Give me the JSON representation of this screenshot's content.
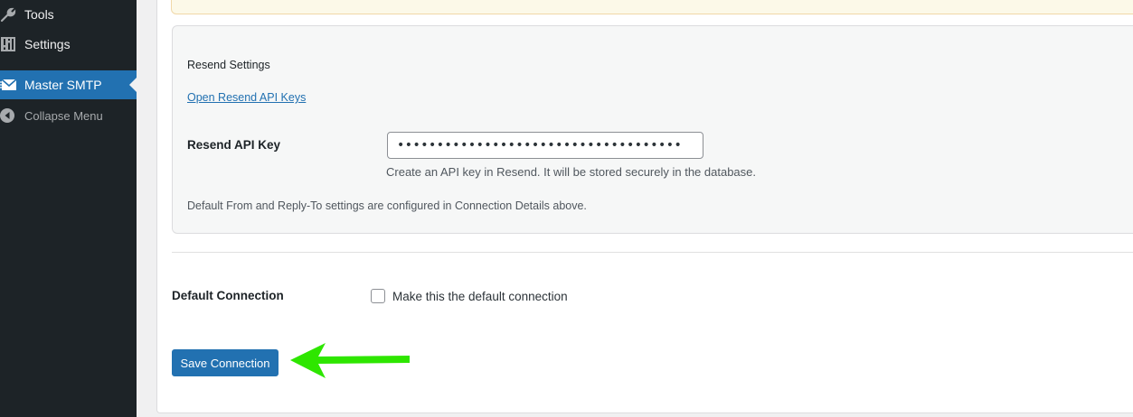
{
  "sidebar": {
    "items": [
      {
        "label": "Tools",
        "icon": "wrench-icon"
      },
      {
        "label": "Settings",
        "icon": "sliders-icon"
      },
      {
        "label": "Master SMTP",
        "icon": "envelope-icon",
        "active": true
      },
      {
        "label": "Collapse Menu",
        "icon": "collapse-icon"
      }
    ]
  },
  "resend": {
    "heading": "Resend Settings",
    "link": "Open Resend API Keys",
    "api_key_label": "Resend API Key",
    "api_key_value": "••••••••••••••••••••••••••••••••••••",
    "api_key_help": "Create an API key in Resend. It will be stored securely in the database.",
    "note": "Default From and Reply-To settings are configured in Connection Details above."
  },
  "default_connection": {
    "label": "Default Connection",
    "checkbox_label": "Make this the default connection",
    "checked": false
  },
  "actions": {
    "save_label": "Save Connection"
  },
  "colors": {
    "sidebar_bg": "#1d2327",
    "accent": "#2271b1",
    "arrow": "#2ee600"
  }
}
